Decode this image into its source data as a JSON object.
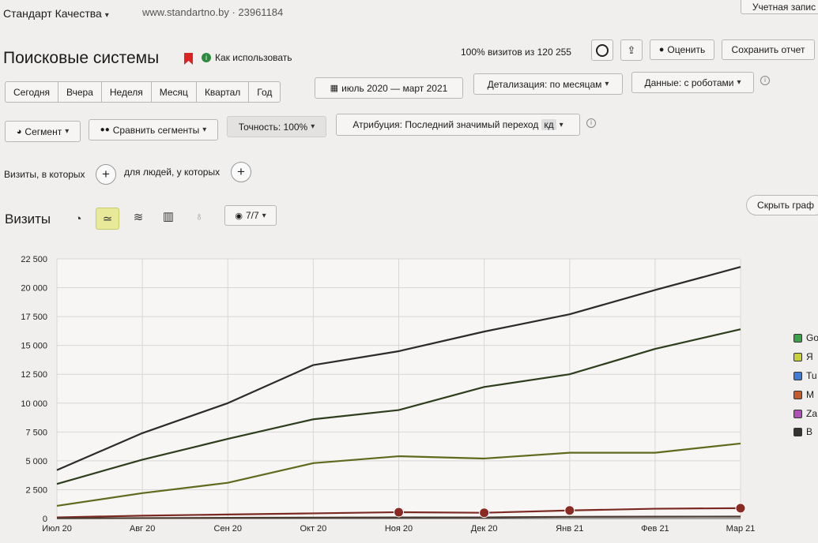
{
  "header": {
    "counter_name": "Стандарт Качества",
    "site": "www.standartno.by · 23961184",
    "account_button": "Учетная запис"
  },
  "report": {
    "title": "Поисковые системы",
    "how_to_use": "Как использовать",
    "visits_info": "100% визитов из 120 255",
    "rate_button": "Оценить",
    "save_report_button": "Сохранить отчет"
  },
  "period_tabs": [
    "Сегодня",
    "Вчера",
    "Неделя",
    "Месяц",
    "Квартал",
    "Год"
  ],
  "date_range": "июль 2020 — март 2021",
  "detail": "Детализация: по месяцам",
  "data_mode": "Данные: с роботами",
  "segment_button": "Сегмент",
  "compare_button": "Сравнить сегменты",
  "accuracy": "Точность: 100%",
  "attribution": "Атрибуция: Последний значимый переход",
  "attribution_badge": "кд",
  "filter": {
    "visits_where": "Визиты, в которых",
    "people_where": "для людей, у которых"
  },
  "chart_header": {
    "metric": "Визиты",
    "series_selector": "7/7",
    "hide_chart": "Скрыть граф"
  },
  "icons": {
    "pie": "pie-chart-icon",
    "line": "line-chart-icon",
    "area": "area-chart-icon",
    "bar": "bar-chart-icon",
    "map": "map-pin-icon"
  },
  "legend": [
    {
      "label": "Go",
      "color": "#3aa24a"
    },
    {
      "label": "Я",
      "color": "#c8cf3a"
    },
    {
      "label": "Tu",
      "color": "#3f7ad6"
    },
    {
      "label": "M",
      "color": "#c65a2a"
    },
    {
      "label": "Za",
      "color": "#b04fb5"
    },
    {
      "label": "В",
      "color": "#333333"
    }
  ],
  "chart_data": {
    "type": "line",
    "categories": [
      "Июл 20",
      "Авг 20",
      "Сен 20",
      "Окт 20",
      "Ноя 20",
      "Дек 20",
      "Янв 21",
      "Фев 21",
      "Мар 21"
    ],
    "ylim": [
      0,
      22500
    ],
    "yticks": [
      0,
      2500,
      5000,
      7500,
      10000,
      12500,
      15000,
      17500,
      20000,
      22500
    ],
    "ytick_labels": [
      "0",
      "2 500",
      "5 000",
      "7 500",
      "10 000",
      "12 500",
      "15 000",
      "17 500",
      "20 000",
      "22 500"
    ],
    "grid": true,
    "legend_position": "right",
    "series": [
      {
        "color": "#2b2b2b",
        "values": [
          4200,
          7400,
          10000,
          13300,
          14500,
          16200,
          17700,
          19800,
          21800
        ]
      },
      {
        "color": "#2e3d1c",
        "values": [
          3000,
          5100,
          6900,
          8600,
          9400,
          11400,
          12500,
          14700,
          16400
        ]
      },
      {
        "color": "#5f6a1c",
        "values": [
          1100,
          2200,
          3100,
          4800,
          5400,
          5200,
          5700,
          5700,
          6500
        ]
      },
      {
        "color": "#7b2a22",
        "values": [
          100,
          250,
          350,
          450,
          550,
          500,
          700,
          850,
          900
        ]
      },
      {
        "color": "#4a3a30",
        "values": [
          20,
          40,
          60,
          80,
          100,
          100,
          150,
          160,
          170
        ]
      }
    ]
  }
}
